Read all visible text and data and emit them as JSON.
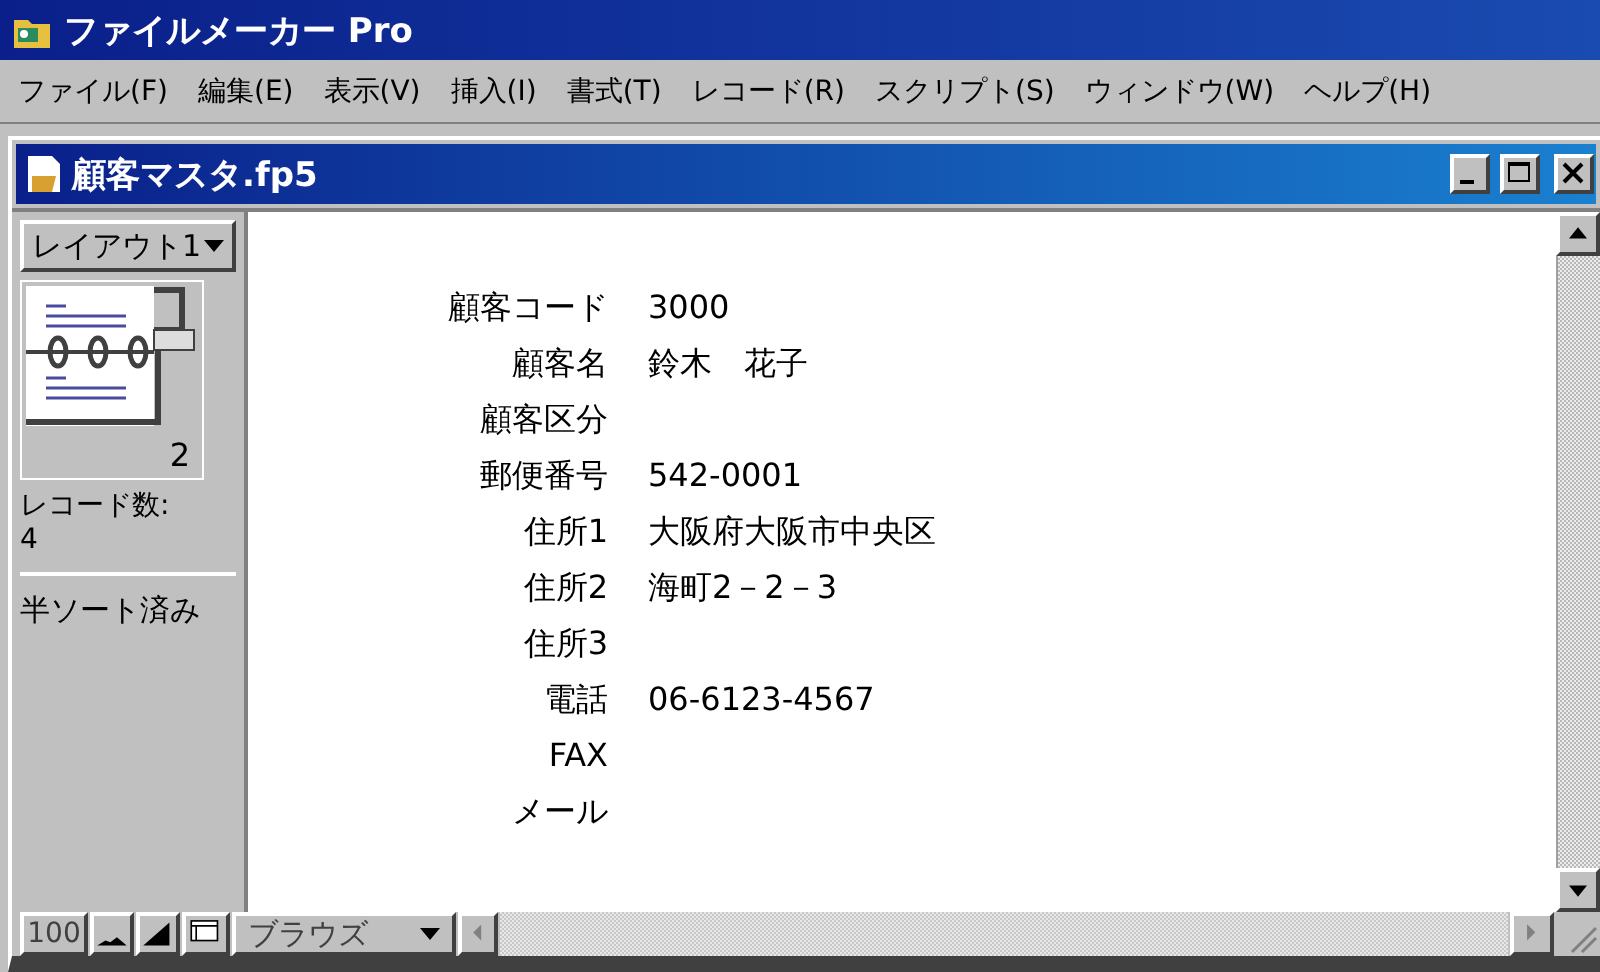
{
  "app": {
    "title": "ファイルメーカー Pro"
  },
  "menu": [
    {
      "label": "ファイル(F)"
    },
    {
      "label": "編集(E)"
    },
    {
      "label": "表示(V)"
    },
    {
      "label": "挿入(I)"
    },
    {
      "label": "書式(T)"
    },
    {
      "label": "レコード(R)"
    },
    {
      "label": "スクリプト(S)"
    },
    {
      "label": "ウィンドウ(W)"
    },
    {
      "label": "ヘルプ(H)"
    }
  ],
  "window": {
    "title": "顧客マスタ.fp5"
  },
  "sidebar": {
    "layout": "レイアウト1",
    "record_number": "2",
    "record_count_label": "レコード数:",
    "record_count": "4",
    "sort_status": "半ソート済み"
  },
  "fields": [
    {
      "label": "顧客コード",
      "value": "3000"
    },
    {
      "label": "顧客名",
      "value": "鈴木　花子"
    },
    {
      "label": "顧客区分"
    },
    {
      "label": "郵便番号",
      "value": "542-0001"
    },
    {
      "label": "住所1",
      "value": "大阪府大阪市中央区"
    },
    {
      "label": "住所2",
      "value": "海町2－2－3"
    },
    {
      "label": "住所3"
    },
    {
      "label": "電話",
      "value": "06-6123-4567"
    },
    {
      "label": "FAX"
    },
    {
      "label": "メール"
    }
  ],
  "status_bar": {
    "zoom": "100",
    "mode": "ブラウズ"
  }
}
